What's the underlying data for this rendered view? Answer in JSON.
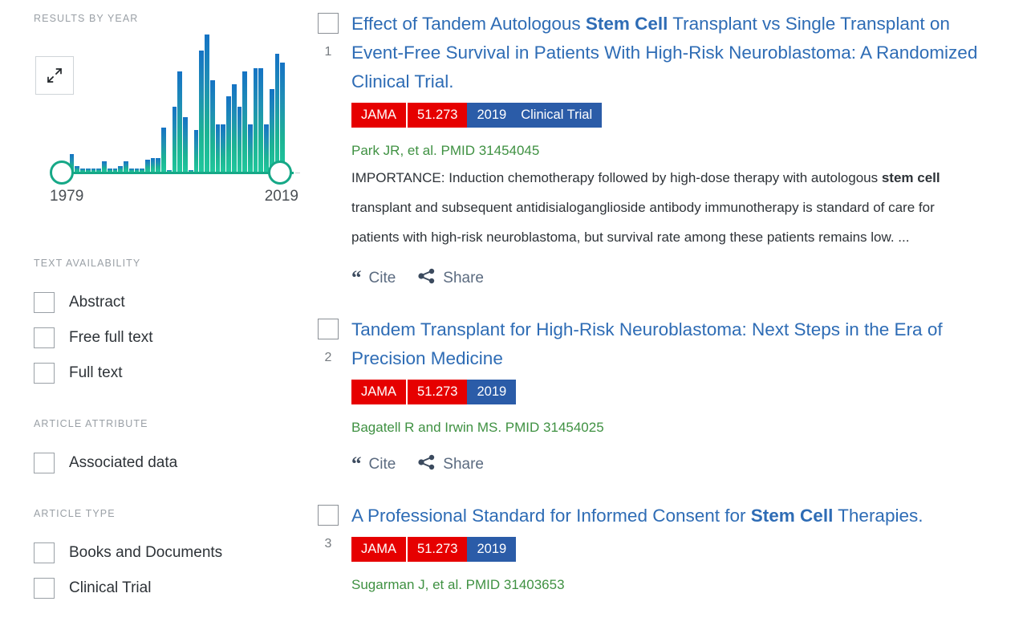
{
  "sidebar": {
    "results_by_year": {
      "title": "RESULTS BY YEAR",
      "expand_icon": "expand-diagonal-icon",
      "year_start": "1979",
      "year_end": "2019"
    },
    "facets": [
      {
        "title": "TEXT AVAILABILITY",
        "options": [
          {
            "label": "Abstract",
            "checked": false
          },
          {
            "label": "Free full text",
            "checked": false
          },
          {
            "label": "Full text",
            "checked": false
          }
        ]
      },
      {
        "title": "ARTICLE ATTRIBUTE",
        "options": [
          {
            "label": "Associated data",
            "checked": false
          }
        ]
      },
      {
        "title": "ARTICLE TYPE",
        "options": [
          {
            "label": "Books and Documents",
            "checked": false
          },
          {
            "label": "Clinical Trial",
            "checked": false
          }
        ]
      }
    ]
  },
  "results": [
    {
      "index": "1",
      "title_parts": [
        {
          "text": "Effect of Tandem Autologous ",
          "bold": false
        },
        {
          "text": "Stem Cell",
          "bold": true
        },
        {
          "text": " Transplant vs Single Transplant on Event-Free Survival in Patients With High-Risk Neuroblastoma: A Randomized Clinical Trial.",
          "bold": false
        }
      ],
      "badges": {
        "journal": "JAMA",
        "impact_factor": "51.273",
        "year": "2019",
        "type": "Clinical Trial"
      },
      "authors": "Park JR, et al. PMID 31454045",
      "snippet_parts": [
        {
          "text": "IMPORTANCE: Induction chemotherapy followed by high-dose therapy with autologous ",
          "bold": false
        },
        {
          "text": "stem cell",
          "bold": true
        },
        {
          "text": " transplant and subsequent antidisialoganglioside antibody immunotherapy is standard of care for patients with high-risk neuroblastoma, but survival rate among these patients remains low. ...",
          "bold": false
        }
      ],
      "actions": [
        {
          "label": "Cite",
          "icon": "quote-icon"
        },
        {
          "label": "Share",
          "icon": "share-icon"
        }
      ]
    },
    {
      "index": "2",
      "title_parts": [
        {
          "text": "Tandem Transplant for High-Risk Neuroblastoma: Next Steps in the Era of Precision Medicine",
          "bold": false
        }
      ],
      "badges": {
        "journal": "JAMA",
        "impact_factor": "51.273",
        "year": "2019",
        "type": ""
      },
      "authors": "Bagatell R and Irwin MS. PMID 31454025",
      "snippet_parts": [],
      "actions": [
        {
          "label": "Cite",
          "icon": "quote-icon"
        },
        {
          "label": "Share",
          "icon": "share-icon"
        }
      ]
    },
    {
      "index": "3",
      "title_parts": [
        {
          "text": "A Professional Standard for Informed Consent for ",
          "bold": false
        },
        {
          "text": "Stem Cell",
          "bold": true
        },
        {
          "text": " Therapies.",
          "bold": false
        }
      ],
      "badges": {
        "journal": "JAMA",
        "impact_factor": "51.273",
        "year": "2019",
        "type": ""
      },
      "authors": "Sugarman J, et al. PMID 31403653",
      "snippet_parts": [],
      "actions": []
    }
  ],
  "colors": {
    "title_link": "#2e6cb5",
    "badge_red": "#e60000",
    "badge_blue": "#2b5ca8",
    "author_green": "#3f9142",
    "slider_teal": "#16a887",
    "bar_top_blue": "#1573c4",
    "bar_bottom_teal": "#20c79c",
    "facet_heading": "#9aa0a6"
  },
  "chart_data": {
    "type": "bar",
    "title": "RESULTS BY YEAR",
    "xlabel": "",
    "ylabel": "",
    "grid": false,
    "legend": null,
    "categories": [
      "1979",
      "1980",
      "1981",
      "1982",
      "1983",
      "1984",
      "1985",
      "1986",
      "1987",
      "1988",
      "1989",
      "1990",
      "1991",
      "1992",
      "1993",
      "1994",
      "1995",
      "1996",
      "1997",
      "1998",
      "1999",
      "2000",
      "2001",
      "2002",
      "2003",
      "2004",
      "2005",
      "2006",
      "2007",
      "2008",
      "2009",
      "2010",
      "2011",
      "2012",
      "2013",
      "2014",
      "2015",
      "2016",
      "2017",
      "2018",
      "2019"
    ],
    "values": [
      1,
      10,
      3,
      2,
      2,
      2,
      2,
      6,
      2,
      2,
      3,
      6,
      2,
      2,
      2,
      7,
      8,
      8,
      25,
      1,
      37,
      57,
      31,
      1,
      24,
      69,
      78,
      52,
      27,
      27,
      43,
      50,
      37,
      57,
      27,
      59,
      59,
      27,
      47,
      67,
      62
    ],
    "ylim": [
      0,
      80
    ],
    "xlim": [
      "1979",
      "2019"
    ],
    "range_slider": {
      "min": "1979",
      "max": "2019"
    }
  }
}
